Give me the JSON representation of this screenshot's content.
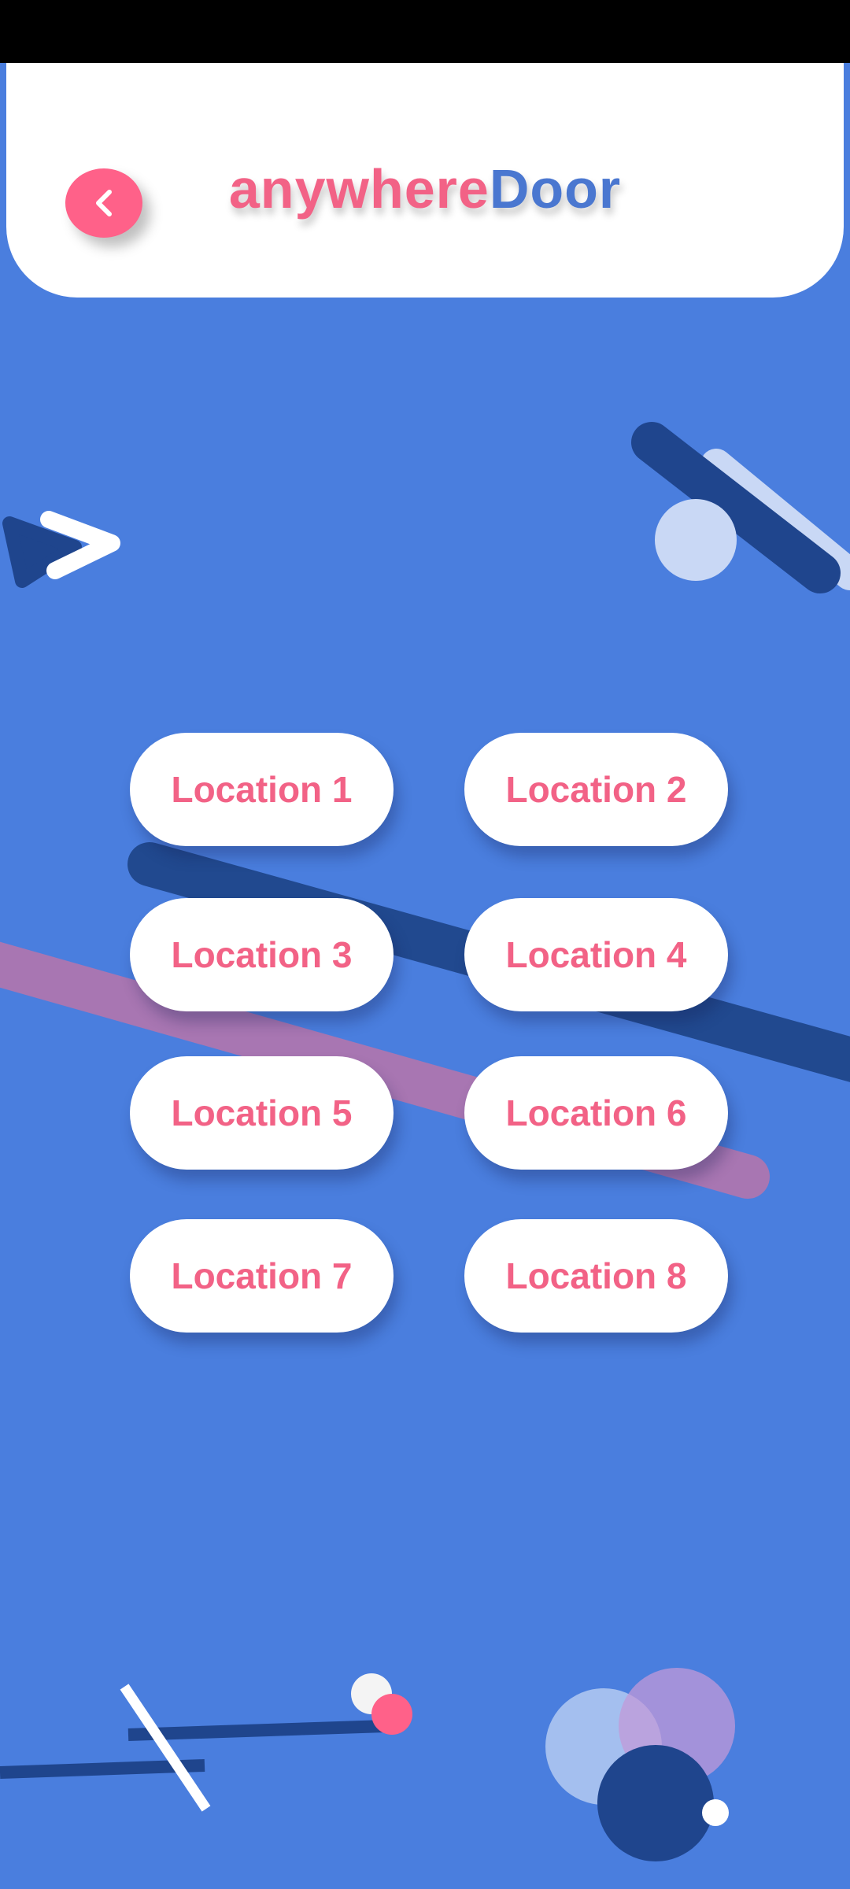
{
  "header": {
    "title_part1": "anywhere",
    "title_part2": "Door",
    "back_icon": "chevron-left-icon"
  },
  "locations": [
    {
      "label": "Location 1"
    },
    {
      "label": "Location 2"
    },
    {
      "label": "Location 3"
    },
    {
      "label": "Location 4"
    },
    {
      "label": "Location 5"
    },
    {
      "label": "Location 6"
    },
    {
      "label": "Location 7"
    },
    {
      "label": "Location 8"
    }
  ],
  "colors": {
    "background": "#4a7ede",
    "accent_pink": "#f26286",
    "accent_blue": "#4a77d0",
    "dark_blue": "#1f458d"
  }
}
